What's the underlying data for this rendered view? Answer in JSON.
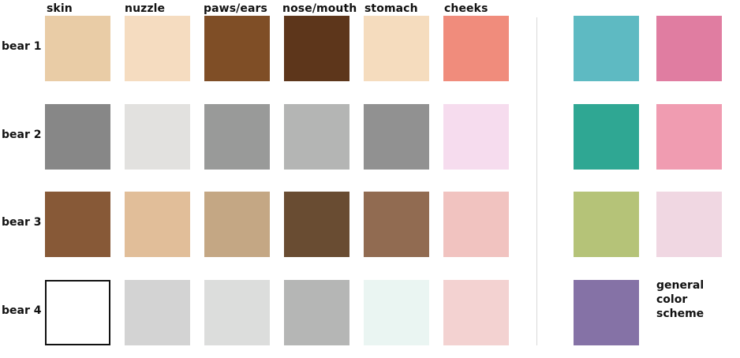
{
  "columns": [
    "skin",
    "nuzzle",
    "paws/ears",
    "nose/mouth",
    "stomach",
    "cheeks"
  ],
  "bears": [
    {
      "label": "bear 1",
      "colors": [
        "#e9cca6",
        "#f5dcc0",
        "#7f4e26",
        "#5d361b",
        "#f5dcbe",
        "#f08c7c"
      ]
    },
    {
      "label": "bear 2",
      "colors": [
        "#878787",
        "#e2e1df",
        "#999a99",
        "#b4b5b4",
        "#919191",
        "#f6dcee"
      ]
    },
    {
      "label": "bear 3",
      "colors": [
        "#875937",
        "#e1be99",
        "#c4a784",
        "#694c32",
        "#916b51",
        "#f1c3c0"
      ]
    },
    {
      "label": "bear 4",
      "colors": [
        "#ffffff",
        "#d3d3d3",
        "#dcdddc",
        "#b5b6b5",
        "#eaf5f2",
        "#f3d2d1"
      ]
    }
  ],
  "scheme": {
    "colors": [
      [
        "#5ebac2",
        "#e07da1"
      ],
      [
        "#2fa793",
        "#f09cb1"
      ],
      [
        "#b5c378",
        "#f0d7e2"
      ],
      [
        "#8572a6",
        null
      ]
    ],
    "label": "general\ncolor\nscheme"
  }
}
